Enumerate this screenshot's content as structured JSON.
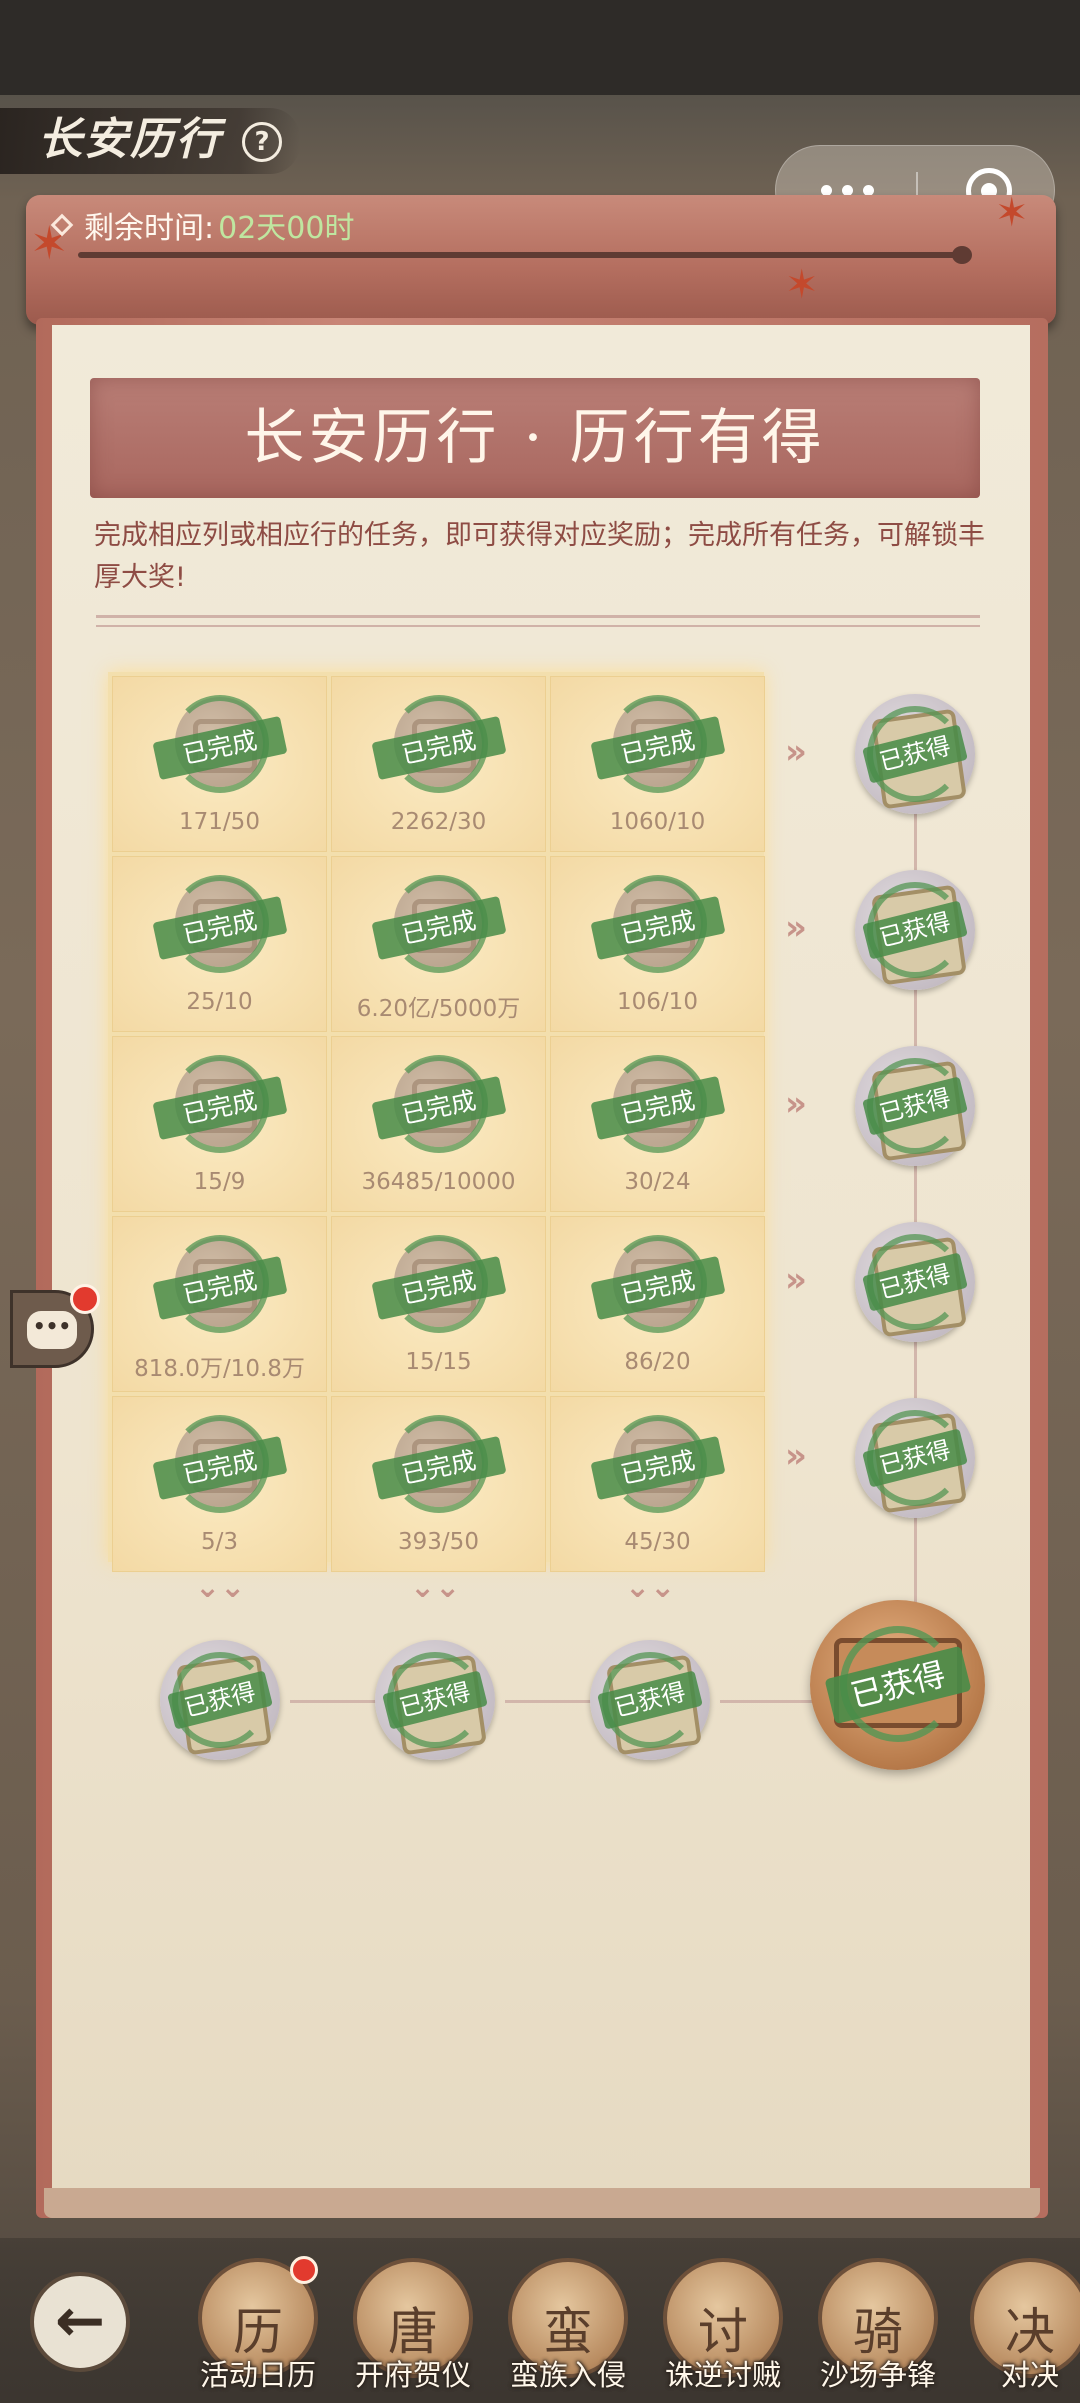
{
  "header": {
    "title": "长安历行",
    "help_icon": "?",
    "remaining_label": "剩余时间:",
    "remaining_value": "02天00时"
  },
  "banner": {
    "title": "长安历行 · 历行有得",
    "description": "完成相应列或相应行的任务，即可获得对应奖励；完成所有任务，可解锁丰厚大奖!"
  },
  "task_grid": {
    "status_label": "已完成",
    "rows": [
      [
        "171/50",
        "2262/30",
        "1060/10"
      ],
      [
        "25/10",
        "6.20亿/5000万",
        "106/10"
      ],
      [
        "15/9",
        "36485/10000",
        "30/24"
      ],
      [
        "818.0万/10.8万",
        "15/15",
        "86/20"
      ],
      [
        "5/3",
        "393/50",
        "45/30"
      ]
    ]
  },
  "rewards": {
    "claimed_label": "已获得",
    "grand_label": "已获得"
  },
  "arrows": {
    "right": "»",
    "down": "⌄⌄"
  },
  "nav": {
    "back_icon": "←",
    "items": [
      {
        "label": "活动日历",
        "glyph": "历"
      },
      {
        "label": "开府贺仪",
        "glyph": "唐"
      },
      {
        "label": "蛮族入侵",
        "glyph": "蛮"
      },
      {
        "label": "诛逆讨贼",
        "glyph": "讨"
      },
      {
        "label": "沙场争锋",
        "glyph": "骑"
      },
      {
        "label": "对决",
        "glyph": "决"
      }
    ]
  },
  "chat": {
    "icon": "•••"
  },
  "capsule": {
    "more": "more-icon",
    "close": "close-icon"
  },
  "colors": {
    "accent_green": "#488c48",
    "banner": "#a9675f",
    "paper": "#f1ead9"
  }
}
